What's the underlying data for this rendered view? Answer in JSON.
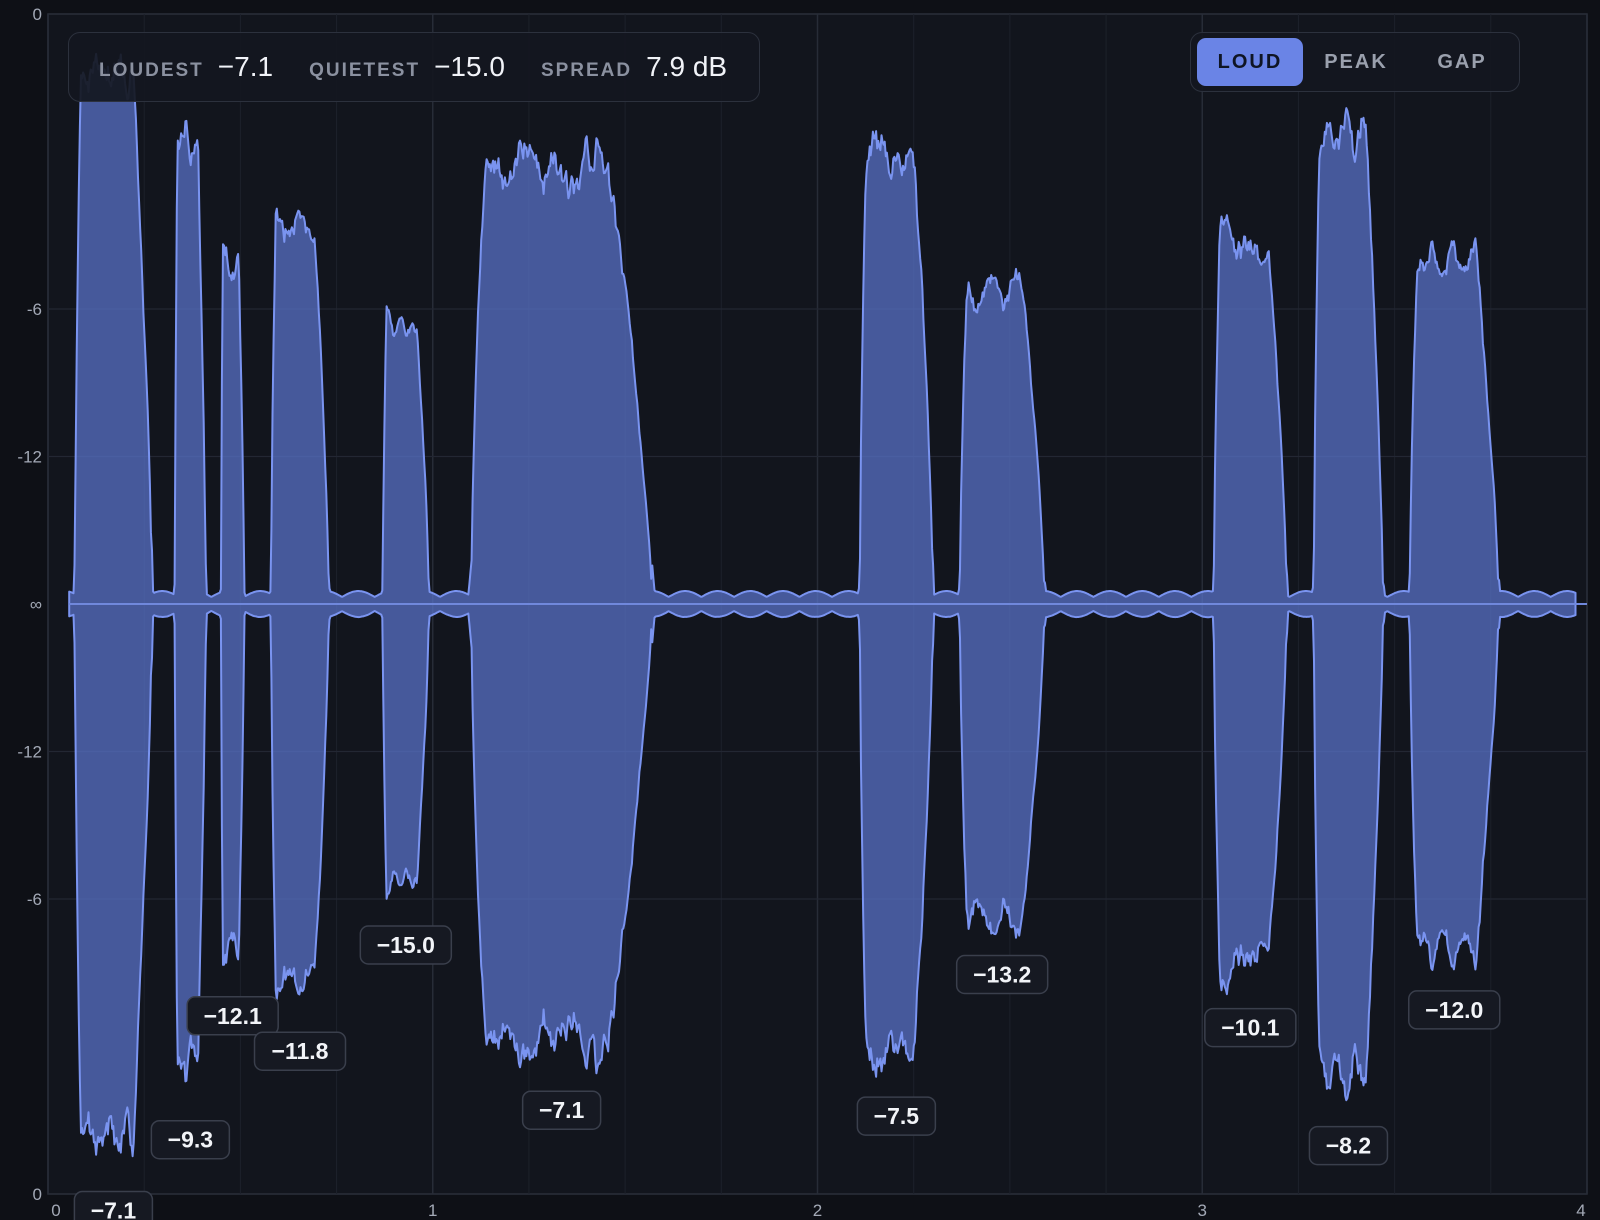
{
  "stats": [
    {
      "label": "LOUDEST",
      "value": "−7.1"
    },
    {
      "label": "QUIETEST",
      "value": "−15.0"
    },
    {
      "label": "SPREAD",
      "value": "7.9 dB"
    }
  ],
  "modes": [
    {
      "label": "LOUD",
      "active": true
    },
    {
      "label": "PEAK",
      "active": false
    },
    {
      "label": "GAP",
      "active": false
    }
  ],
  "chart_data": {
    "type": "area",
    "x_range": [
      0,
      4
    ],
    "x_ticks": [
      "0",
      "1",
      "2",
      "3",
      "4"
    ],
    "y_ticks": [
      "0",
      "-6",
      "-12",
      "∞",
      "-12",
      "-6",
      "0"
    ],
    "grid": true,
    "colors": {
      "fill": "#5a74cc",
      "stroke": "#7a94f0",
      "background": "#0e1016"
    },
    "segments": [
      {
        "start": 0.07,
        "end": 0.27,
        "peak": 0.95,
        "label": "−7.1"
      },
      {
        "start": 0.33,
        "end": 0.41,
        "peak": 0.83,
        "label": "−9.3"
      },
      {
        "start": 0.45,
        "end": 0.51,
        "peak": 0.62,
        "label": "−12.1"
      },
      {
        "start": 0.58,
        "end": 0.73,
        "peak": 0.68,
        "label": "−11.8"
      },
      {
        "start": 0.87,
        "end": 0.99,
        "peak": 0.5,
        "label": "−15.0"
      },
      {
        "start": 1.1,
        "end": 1.57,
        "peak": 0.78,
        "label": "−7.1"
      },
      {
        "start": 2.11,
        "end": 2.3,
        "peak": 0.79,
        "label": "−7.5"
      },
      {
        "start": 2.37,
        "end": 2.59,
        "peak": 0.55,
        "label": "−13.2"
      },
      {
        "start": 3.03,
        "end": 3.22,
        "peak": 0.64,
        "label": "−10.1"
      },
      {
        "start": 3.29,
        "end": 3.47,
        "peak": 0.84,
        "label": "−8.2"
      },
      {
        "start": 3.54,
        "end": 3.77,
        "peak": 0.61,
        "label": "−12.0"
      }
    ]
  }
}
